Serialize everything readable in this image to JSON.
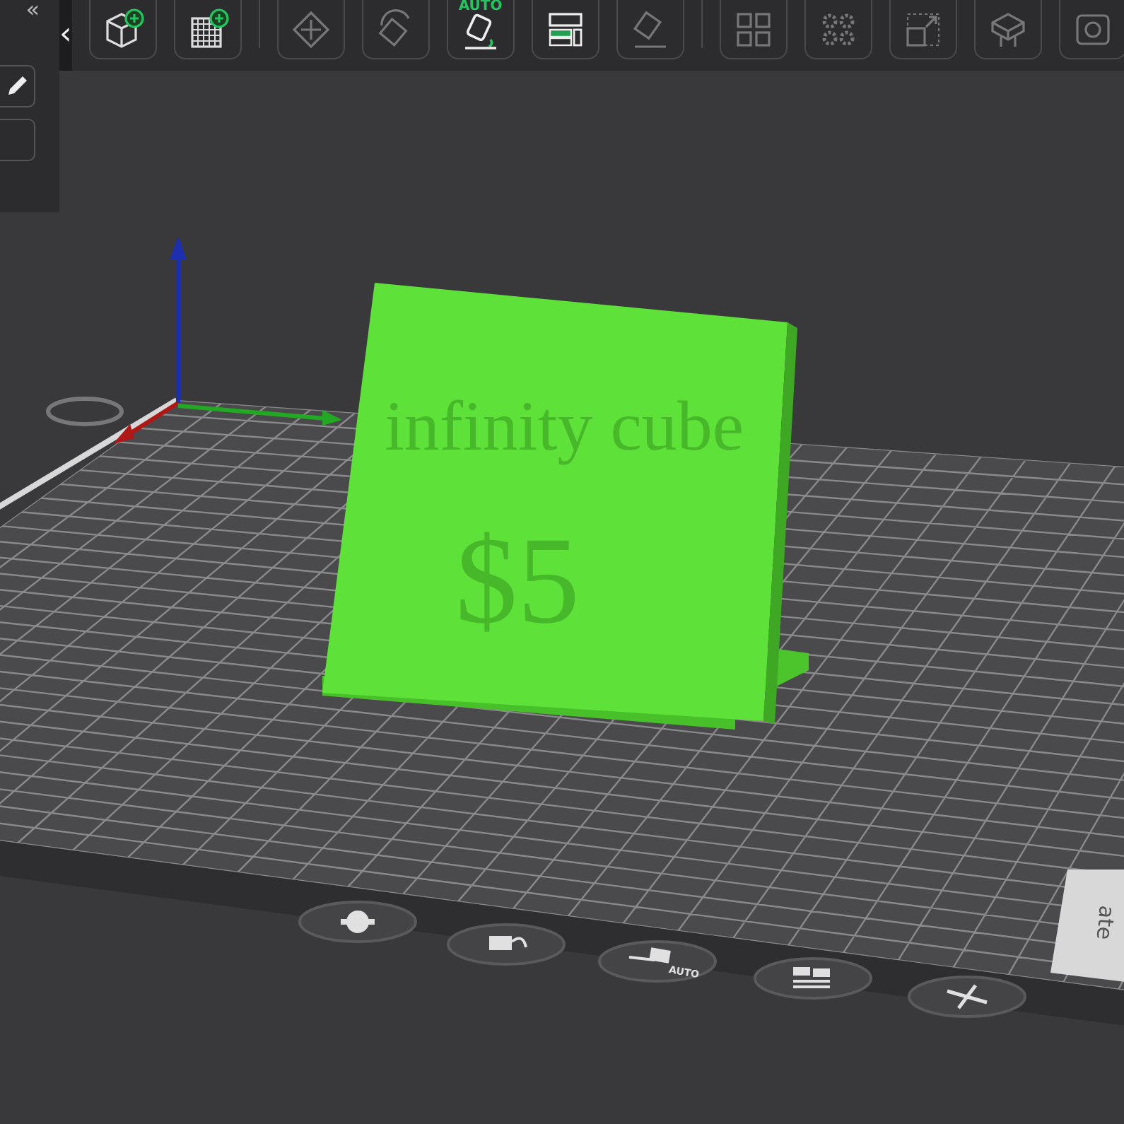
{
  "side_panel": {
    "collapse_glyph": "«",
    "buttons": [
      {
        "kind": "edit"
      },
      {
        "kind": "blank"
      }
    ]
  },
  "toolbar": {
    "collapse_glyph": "‹",
    "buttons": [
      {
        "kind": "add-object"
      },
      {
        "kind": "add-plate"
      },
      {
        "kind": "separator"
      },
      {
        "kind": "move"
      },
      {
        "kind": "rotate"
      },
      {
        "kind": "auto-orient",
        "label": "AUTO"
      },
      {
        "kind": "arrange"
      },
      {
        "kind": "lay-on-face"
      },
      {
        "kind": "separator"
      },
      {
        "kind": "split-grid"
      },
      {
        "kind": "split-gears"
      },
      {
        "kind": "scale"
      },
      {
        "kind": "support"
      },
      {
        "kind": "cut"
      }
    ]
  },
  "model": {
    "text_lines": [
      "infinity cube",
      "$5"
    ]
  },
  "plate": {
    "tab_label": "ate",
    "controls": [
      {
        "kind": "settings"
      },
      {
        "kind": "lock"
      },
      {
        "kind": "auto-orient",
        "label": "AUTO"
      },
      {
        "kind": "arrange"
      },
      {
        "kind": "close"
      }
    ]
  }
}
